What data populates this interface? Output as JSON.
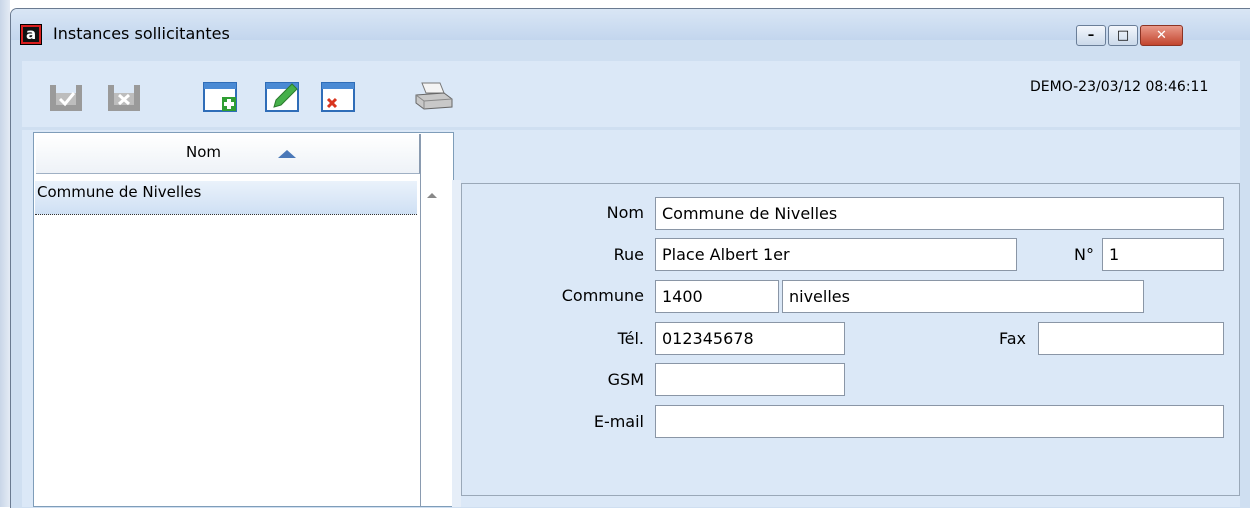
{
  "window": {
    "title": "Instances sollicitantes",
    "app_icon_glyph": "a",
    "controls": {
      "minimize": "–",
      "maximize": "□",
      "close": "✕"
    }
  },
  "toolbar": {
    "status_stamp": "DEMO-23/03/12 08:46:11",
    "buttons": [
      {
        "name": "save",
        "icon": "save-check-icon"
      },
      {
        "name": "cancel",
        "icon": "cancel-x-icon"
      },
      {
        "name": "new",
        "icon": "window-add-icon"
      },
      {
        "name": "edit",
        "icon": "window-edit-icon"
      },
      {
        "name": "delete",
        "icon": "window-delete-icon"
      },
      {
        "name": "print",
        "icon": "printer-icon"
      }
    ]
  },
  "list": {
    "column_header": "Nom",
    "sort": "ascending",
    "rows": [
      "Commune de Nivelles"
    ]
  },
  "form": {
    "labels": {
      "nom": "Nom",
      "rue": "Rue",
      "numero": "N°",
      "commune": "Commune",
      "tel": "Tél.",
      "fax": "Fax",
      "gsm": "GSM",
      "email": "E-mail"
    },
    "values": {
      "nom": "Commune de Nivelles",
      "rue": "Place Albert 1er",
      "numero": "1",
      "code_postal": "1400",
      "localite": "nivelles",
      "tel": "012345678",
      "fax": "",
      "gsm": "",
      "email": ""
    }
  },
  "colors": {
    "window_bg": "#dbe8f7",
    "selection": "#cfe0f4",
    "close_button": "#c2452e"
  }
}
